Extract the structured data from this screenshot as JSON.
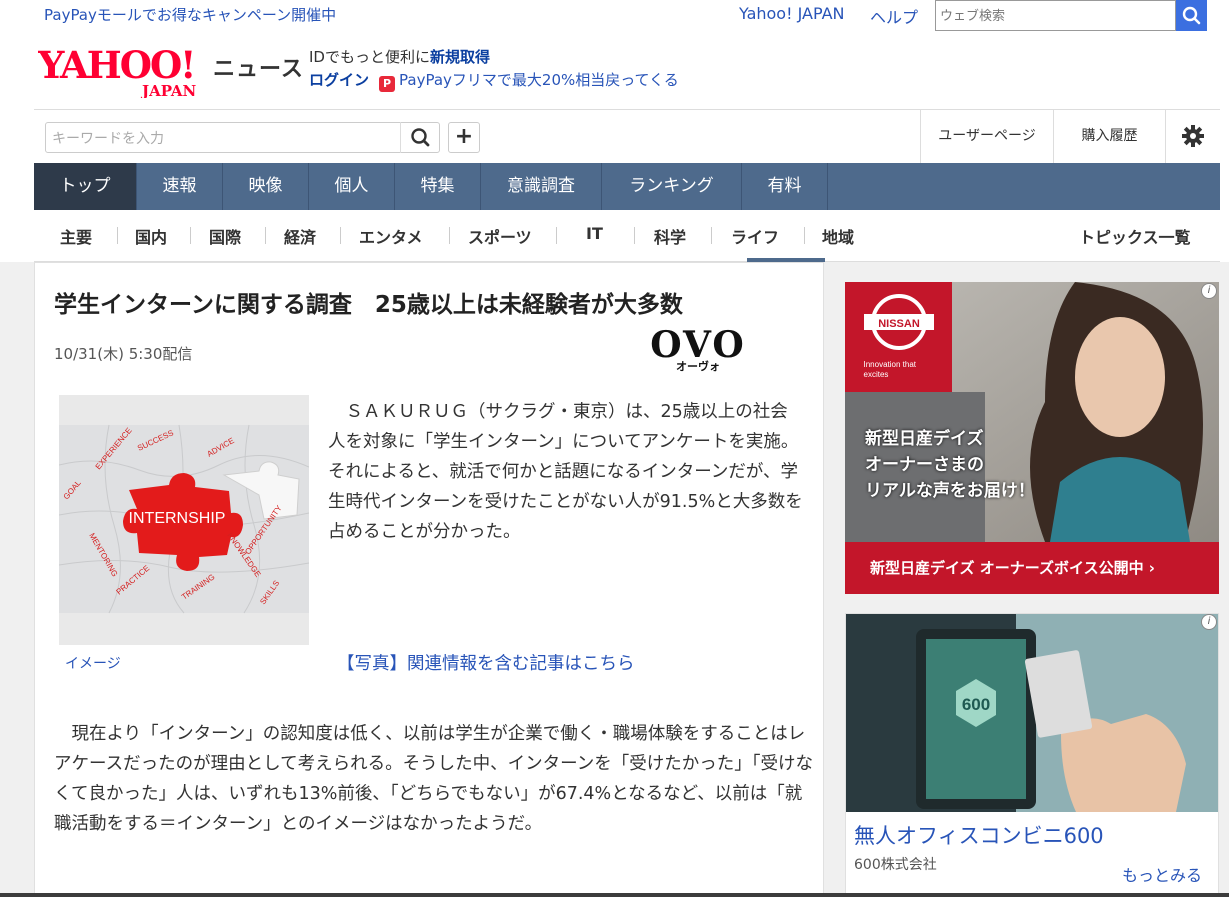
{
  "topbar": {
    "promo": "PayPayモールでお得なキャンペーン開催中",
    "yahoo_japan": "Yahoo! JAPAN",
    "help": "ヘルプ",
    "web_search_placeholder": "ウェブ検索"
  },
  "header": {
    "logo_main": "YAHOO!",
    "logo_sub": "JAPAN",
    "service": "ニュース",
    "id_prefix": "IDでもっと便利に",
    "id_signup": "新規取得",
    "login": "ログイン",
    "paypay_promo": "PayPayフリマで最大20%相当戻ってくる"
  },
  "toolbar": {
    "keyword_placeholder": "キーワードを入力",
    "user_page": "ユーザーページ",
    "purchase_history": "購入履歴"
  },
  "main_nav": {
    "items": [
      "トップ",
      "速報",
      "映像",
      "個人",
      "特集",
      "意識調査",
      "ランキング",
      "有料"
    ],
    "active": "トップ"
  },
  "sub_nav": {
    "items": [
      "主要",
      "国内",
      "国際",
      "経済",
      "エンタメ",
      "スポーツ",
      "IT",
      "科学",
      "ライフ",
      "地域"
    ],
    "active": "ライフ",
    "topics": "トピックス一覧"
  },
  "article": {
    "title": "学生インターンに関する調査　25歳以上は未経験者が大多数",
    "date": "10/31(木) 5:30配信",
    "source_logo": "OVO",
    "source_logo_kana": "オーヴォ",
    "photo_caption": "イメージ",
    "photo_words": [
      "SUCCESS",
      "ADVICE",
      "EXPERIENCE",
      "GOAL",
      "MENTORING",
      "INTERNSHIP",
      "KNOWLEDGE",
      "OPPORTUNITY",
      "PRACTICE",
      "TRAINING",
      "SKILLS"
    ],
    "lead": "ＳＡＫＵＲＵＧ（サクラグ・東京）は、25歳以上の社会人を対象に「学生インターン」についてアンケートを実施。それによると、就活で何かと話題になるインターンだが、学生時代インターンを受けたことがない人が91.5%と大多数を占めることが分かった。",
    "related_link": "【写真】関連情報を含む記事はこちら",
    "body": "現在より「インターン」の認知度は低く、以前は学生が企業で働く・職場体験をすることはレアケースだったのが理由として考えられる。そうした中、インターンを「受けたかった」「受けなくて良かった」人は、いずれも13%前後、「どちらでもない」が67.4%となるなど、以前は「就職活動をする＝インターン」とのイメージはなかったようだ。"
  },
  "ads": {
    "nissan": {
      "brand": "NISSAN",
      "tagline": "Innovation that excites",
      "headline_lines": [
        "新型日産デイズ",
        "オーナーさまの",
        "リアルな声をお届け！"
      ],
      "bar": "新型日産デイズ オーナーズボイス公開中 ›"
    },
    "office": {
      "title": "無人オフィスコンビニ600",
      "company": "600株式会社",
      "more": "もっとみる",
      "screen_number": "600"
    },
    "info_icon": "i"
  },
  "colors": {
    "nav_bg": "#4e6a8c",
    "nav_active": "#2e3a4a",
    "link": "#2854b8",
    "logo_red": "#ff0033",
    "nissan_red": "#c3162a",
    "search_blue": "#3b6fe0"
  }
}
